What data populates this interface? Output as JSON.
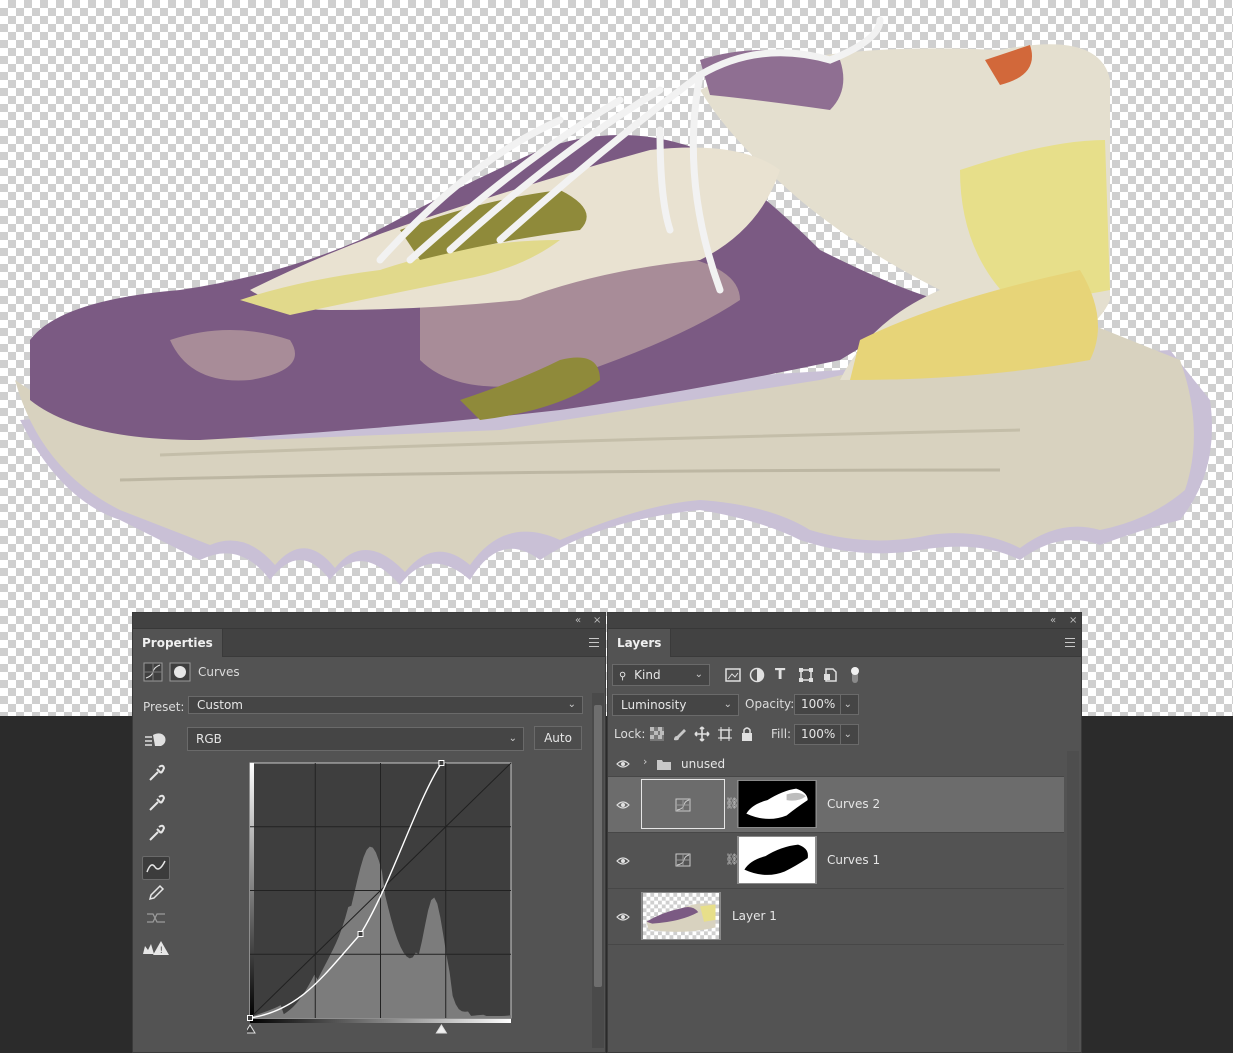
{
  "canvas": {
    "description_colors": {
      "upper": "#7b5a83",
      "sole": "#d8d2bf",
      "accent": "#d8cd7a",
      "outsole": "#c9c0d6"
    }
  },
  "properties_panel": {
    "tab": "Properties",
    "adjustment_name": "Curves",
    "preset_label": "Preset:",
    "preset_value": "Custom",
    "channel_value": "RGB",
    "auto_label": "Auto",
    "chart_data": {
      "type": "line",
      "title": "",
      "xlim": [
        0,
        255
      ],
      "ylim": [
        0,
        255
      ],
      "grid": "4x4",
      "series": [
        {
          "values": [
            [
              0,
              0
            ],
            [
              108,
              84
            ],
            [
              187,
              255
            ]
          ]
        }
      ],
      "baseline": [
        [
          0,
          0
        ],
        [
          255,
          255
        ]
      ],
      "histogram_peaks": [
        "midtones",
        "highlights"
      ]
    }
  },
  "layers_panel": {
    "tab": "Layers",
    "kind_label": "Kind",
    "blend_mode": "Luminosity",
    "opacity_label": "Opacity:",
    "opacity_value": "100%",
    "lock_label": "Lock:",
    "fill_label": "Fill:",
    "fill_value": "100%",
    "layers": [
      {
        "name": "unused",
        "type": "group"
      },
      {
        "name": "Curves 2",
        "type": "adjustment",
        "selected": true
      },
      {
        "name": "Curves 1",
        "type": "adjustment"
      },
      {
        "name": "Layer 1",
        "type": "pixel"
      }
    ]
  },
  "colors": {
    "panel_bg": "#535353",
    "selected_row": "#6c6c6c",
    "dark_bg": "#2b2b2b"
  }
}
